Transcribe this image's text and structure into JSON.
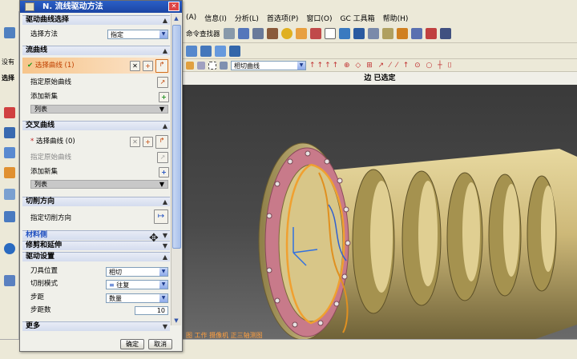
{
  "menubar": {
    "items": [
      "(A)",
      "信息(I)",
      "分析(L)",
      "首选项(P)",
      "窗口(O)",
      "GC 工具箱",
      "帮助(H)"
    ],
    "command_finder": "命令查找器"
  },
  "toolbar": {
    "filter_combo": "相切曲线"
  },
  "viewport": {
    "status_text": "边 已选定",
    "bottom_label": "图 工作 摄像机 正三轴测图"
  },
  "leftstrip": {
    "label_1": "没有",
    "label_2": "选择"
  },
  "dialog": {
    "title": "N. 流线驱动方法",
    "sections": {
      "drive_curve_select": "驱动曲线选择",
      "flow_curve": "流曲线",
      "cross_curve": "交叉曲线",
      "cut_direction": "切削方向",
      "material_side": "材料侧",
      "trim_extend": "修剪和延伸",
      "drive_settings": "驱动设置",
      "more": "更多"
    },
    "selection_method_label": "选择方法",
    "selection_method_value": "指定",
    "flow": {
      "select_curve": "选择曲线 (1)",
      "specify_origin": "指定原始曲线",
      "add_new_set": "添加新集",
      "list": "列表"
    },
    "cross": {
      "select_curve": "选择曲线 (0)",
      "specify_origin": "指定原始曲线",
      "add_new_set": "添加新集",
      "list": "列表"
    },
    "cut_dir_label": "指定切削方向",
    "settings": {
      "tool_position_label": "刀具位置",
      "tool_position_value": "相切",
      "cut_mode_label": "切削模式",
      "cut_mode_value": "往复",
      "stepover_label": "步距",
      "stepover_value": "数量",
      "step_count_label": "步距数",
      "step_count_value": "10"
    },
    "ok_button": "确定",
    "cancel_button": "取消"
  },
  "colors": {
    "title_bar": "#1c45a4",
    "highlight_row": "#f7c58b",
    "part_body": "#cdb878",
    "flange": "#c87a8a",
    "viewport_bg": "#3a3a3a"
  }
}
